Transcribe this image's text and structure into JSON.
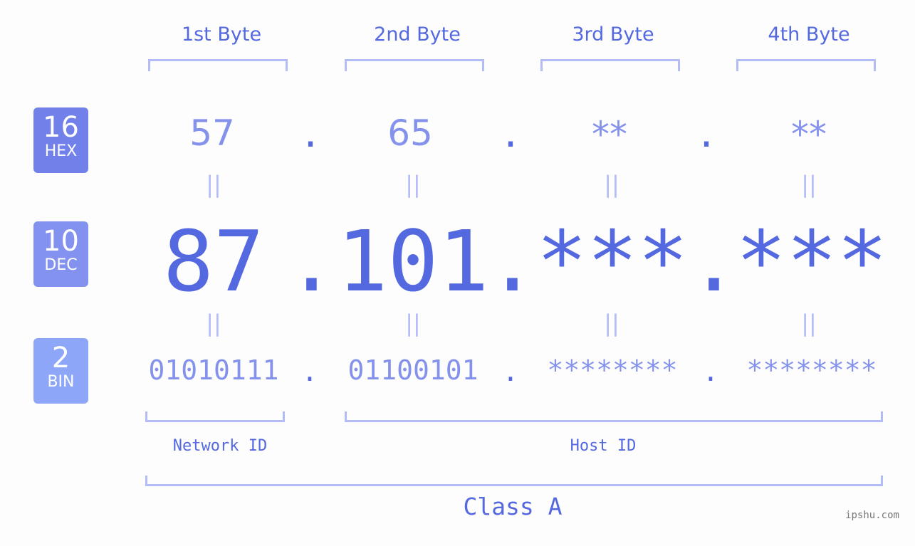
{
  "bytes": [
    {
      "header": "1st Byte",
      "hex": "57",
      "dec": "87",
      "bin": "01010111"
    },
    {
      "header": "2nd Byte",
      "hex": "65",
      "dec": "101",
      "bin": "01100101"
    },
    {
      "header": "3rd Byte",
      "hex": "**",
      "dec": "***",
      "bin": "********"
    },
    {
      "header": "4th Byte",
      "hex": "**",
      "dec": "***",
      "bin": "********"
    }
  ],
  "separator": ".",
  "equals": "||",
  "badges": {
    "hex": {
      "number": "16",
      "label": "HEX",
      "color": "#7281ea"
    },
    "dec": {
      "number": "10",
      "label": "DEC",
      "color": "#8492ef"
    },
    "bin": {
      "number": "2",
      "label": "BIN",
      "color": "#8da6f8"
    }
  },
  "network_label": "Network ID",
  "host_label": "Host ID",
  "class_label": "Class A",
  "watermark": "ipshu.com"
}
